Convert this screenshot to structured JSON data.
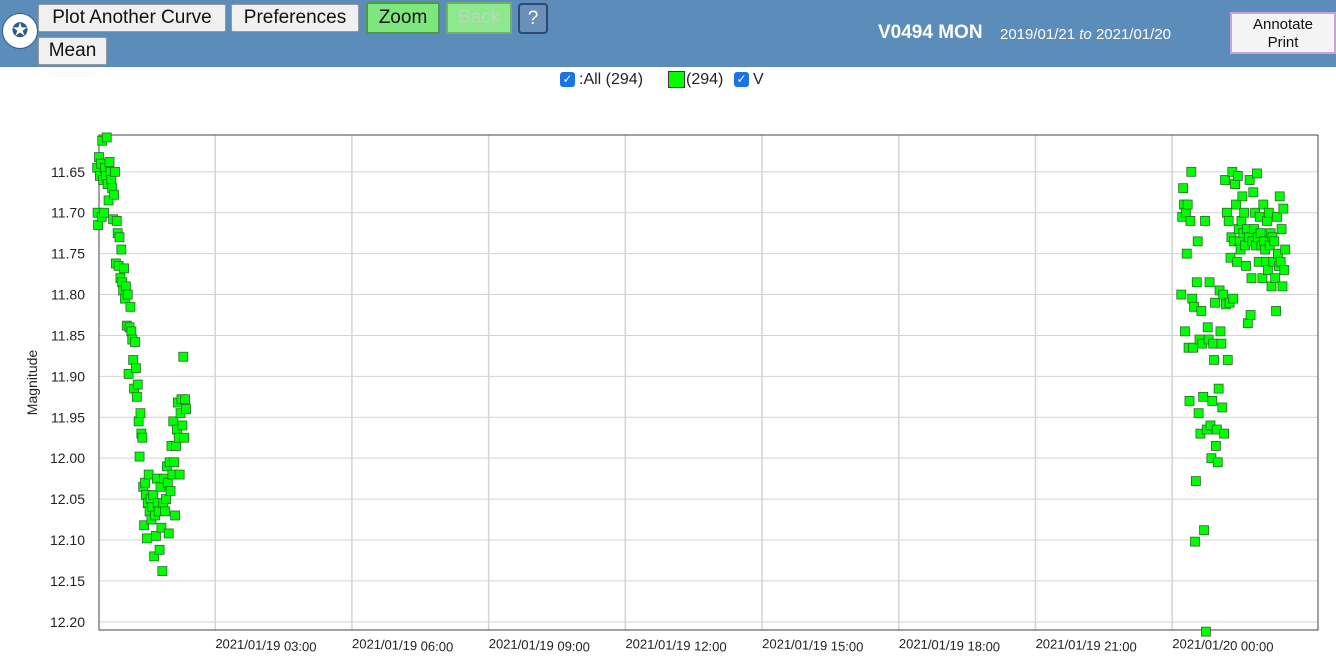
{
  "toolbar": {
    "plot_another": "Plot Another Curve",
    "preferences": "Preferences",
    "zoom": "Zoom",
    "back": "Back",
    "help": "?",
    "mean": "Mean",
    "annotate_line1": "Annotate",
    "annotate_line2": "Print"
  },
  "header": {
    "star_name": "V0494 MON",
    "date_from": "2019/01/21",
    "to_word": "to",
    "date_to": "2021/01/20"
  },
  "legend": {
    "all_label": ":All (294)",
    "count_label": "(294)",
    "band_label": "V"
  },
  "colors": {
    "header_bg": "#5b8cba",
    "point_fill": "#00ff00",
    "point_stroke": "#2a6a2a",
    "grid": "#d4d4d4"
  },
  "chart_data": {
    "type": "scatter",
    "ylabel": "Magnitude",
    "y_inverted": true,
    "ylim": [
      12.21,
      11.605
    ],
    "y_ticks": [
      11.65,
      11.7,
      11.75,
      11.8,
      11.85,
      11.9,
      11.95,
      12.0,
      12.05,
      12.1,
      12.15,
      12.2
    ],
    "y_tick_labels": [
      "11.65",
      "11.70",
      "11.75",
      "11.80",
      "11.85",
      "11.90",
      "11.95",
      "12.00",
      "12.05",
      "12.10",
      "12.15",
      "12.20"
    ],
    "x_unit": "hours after 2021/01/19 00:00",
    "xlim": [
      0.45,
      27.2
    ],
    "x_ticks": [
      3,
      6,
      9,
      12,
      15,
      18,
      21,
      24
    ],
    "x_tick_labels": [
      "2021/01/19 03:00",
      "2021/01/19 06:00",
      "2021/01/19 09:00",
      "2021/01/19 12:00",
      "2021/01/19 15:00",
      "2021/01/19 18:00",
      "2021/01/19 21:00",
      "2021/01/20 00:00"
    ],
    "grid": true,
    "legend_position": "top-center",
    "series": [
      {
        "name": "V",
        "count": 294,
        "points": [
          [
            0.41,
            11.645
          ],
          [
            0.42,
            11.7
          ],
          [
            0.43,
            11.715
          ],
          [
            0.45,
            11.632
          ],
          [
            0.47,
            11.655
          ],
          [
            0.49,
            11.64
          ],
          [
            0.51,
            11.705
          ],
          [
            0.52,
            11.612
          ],
          [
            0.54,
            11.66
          ],
          [
            0.56,
            11.7
          ],
          [
            0.58,
            11.645
          ],
          [
            0.6,
            11.655
          ],
          [
            0.62,
            11.608
          ],
          [
            0.64,
            11.665
          ],
          [
            0.66,
            11.685
          ],
          [
            0.68,
            11.638
          ],
          [
            0.7,
            11.65
          ],
          [
            0.72,
            11.66
          ],
          [
            0.74,
            11.67
          ],
          [
            0.76,
            11.708
          ],
          [
            0.78,
            11.678
          ],
          [
            0.8,
            11.65
          ],
          [
            0.82,
            11.762
          ],
          [
            0.84,
            11.71
          ],
          [
            0.86,
            11.725
          ],
          [
            0.88,
            11.765
          ],
          [
            0.9,
            11.73
          ],
          [
            0.92,
            11.78
          ],
          [
            0.94,
            11.745
          ],
          [
            0.96,
            11.785
          ],
          [
            0.98,
            11.795
          ],
          [
            1.0,
            11.768
          ],
          [
            1.02,
            11.805
          ],
          [
            1.04,
            11.79
          ],
          [
            1.06,
            11.838
          ],
          [
            1.08,
            11.8
          ],
          [
            1.1,
            11.897
          ],
          [
            1.12,
            11.84
          ],
          [
            1.14,
            11.815
          ],
          [
            1.16,
            11.845
          ],
          [
            1.18,
            11.855
          ],
          [
            1.2,
            11.88
          ],
          [
            1.22,
            11.915
          ],
          [
            1.24,
            11.858
          ],
          [
            1.26,
            11.89
          ],
          [
            1.28,
            11.925
          ],
          [
            1.3,
            11.91
          ],
          [
            1.32,
            11.955
          ],
          [
            1.34,
            11.998
          ],
          [
            1.36,
            11.945
          ],
          [
            1.38,
            11.97
          ],
          [
            1.4,
            11.975
          ],
          [
            1.42,
            12.035
          ],
          [
            1.44,
            12.082
          ],
          [
            1.46,
            12.03
          ],
          [
            1.48,
            12.045
          ],
          [
            1.5,
            12.098
          ],
          [
            1.52,
            12.055
          ],
          [
            1.54,
            12.02
          ],
          [
            1.56,
            12.065
          ],
          [
            1.58,
            12.05
          ],
          [
            1.6,
            12.075
          ],
          [
            1.62,
            12.06
          ],
          [
            1.64,
            12.045
          ],
          [
            1.66,
            12.12
          ],
          [
            1.68,
            12.07
          ],
          [
            1.7,
            12.095
          ],
          [
            1.72,
            12.025
          ],
          [
            1.74,
            12.055
          ],
          [
            1.76,
            12.065
          ],
          [
            1.78,
            12.112
          ],
          [
            1.8,
            12.035
          ],
          [
            1.82,
            12.085
          ],
          [
            1.84,
            12.138
          ],
          [
            1.86,
            12.055
          ],
          [
            1.88,
            12.025
          ],
          [
            1.9,
            12.065
          ],
          [
            1.92,
            12.05
          ],
          [
            1.94,
            12.01
          ],
          [
            1.96,
            12.03
          ],
          [
            1.98,
            12.092
          ],
          [
            2.0,
            12.005
          ],
          [
            2.02,
            12.04
          ],
          [
            2.04,
            11.985
          ],
          [
            2.06,
            12.02
          ],
          [
            2.08,
            11.955
          ],
          [
            2.1,
            12.005
          ],
          [
            2.12,
            12.07
          ],
          [
            2.14,
            11.985
          ],
          [
            2.16,
            11.965
          ],
          [
            2.18,
            11.932
          ],
          [
            2.2,
            11.975
          ],
          [
            2.22,
            12.02
          ],
          [
            2.24,
            11.945
          ],
          [
            2.26,
            11.928
          ],
          [
            2.28,
            11.96
          ],
          [
            2.3,
            11.876
          ],
          [
            2.32,
            11.975
          ],
          [
            2.34,
            11.928
          ],
          [
            2.36,
            11.94
          ],
          [
            24.2,
            11.8
          ],
          [
            24.22,
            11.705
          ],
          [
            24.24,
            11.67
          ],
          [
            24.26,
            11.69
          ],
          [
            24.28,
            11.845
          ],
          [
            24.3,
            11.7
          ],
          [
            24.32,
            11.75
          ],
          [
            24.34,
            11.69
          ],
          [
            24.36,
            11.865
          ],
          [
            24.38,
            11.93
          ],
          [
            24.4,
            11.71
          ],
          [
            24.42,
            11.65
          ],
          [
            24.44,
            11.805
          ],
          [
            24.46,
            11.865
          ],
          [
            24.48,
            11.815
          ],
          [
            24.5,
            12.102
          ],
          [
            24.52,
            12.028
          ],
          [
            24.54,
            11.785
          ],
          [
            24.56,
            11.735
          ],
          [
            24.58,
            11.945
          ],
          [
            24.6,
            11.855
          ],
          [
            24.62,
            11.97
          ],
          [
            24.64,
            11.82
          ],
          [
            24.66,
            11.86
          ],
          [
            24.68,
            11.925
          ],
          [
            24.7,
            12.088
          ],
          [
            24.72,
            11.71
          ],
          [
            24.74,
            12.212
          ],
          [
            24.76,
            11.965
          ],
          [
            24.78,
            11.84
          ],
          [
            24.8,
            11.855
          ],
          [
            24.82,
            11.785
          ],
          [
            24.84,
            11.96
          ],
          [
            24.86,
            12.0
          ],
          [
            24.88,
            11.93
          ],
          [
            24.9,
            11.86
          ],
          [
            24.92,
            11.88
          ],
          [
            24.94,
            11.81
          ],
          [
            24.96,
            11.985
          ],
          [
            24.98,
            11.965
          ],
          [
            25.0,
            12.005
          ],
          [
            25.02,
            11.915
          ],
          [
            25.04,
            11.795
          ],
          [
            25.06,
            11.845
          ],
          [
            25.08,
            11.86
          ],
          [
            25.1,
            11.938
          ],
          [
            25.12,
            11.8
          ],
          [
            25.14,
            11.97
          ],
          [
            25.16,
            11.66
          ],
          [
            25.18,
            11.812
          ],
          [
            25.2,
            11.7
          ],
          [
            25.22,
            11.88
          ],
          [
            25.24,
            11.71
          ],
          [
            25.26,
            11.81
          ],
          [
            25.28,
            11.755
          ],
          [
            25.3,
            11.73
          ],
          [
            25.32,
            11.65
          ],
          [
            25.34,
            11.805
          ],
          [
            25.36,
            11.735
          ],
          [
            25.38,
            11.665
          ],
          [
            25.4,
            11.69
          ],
          [
            25.42,
            11.76
          ],
          [
            25.44,
            11.655
          ],
          [
            25.46,
            11.72
          ],
          [
            25.48,
            11.735
          ],
          [
            25.5,
            11.745
          ],
          [
            25.52,
            11.71
          ],
          [
            25.54,
            11.68
          ],
          [
            25.56,
            11.725
          ],
          [
            25.58,
            11.7
          ],
          [
            25.6,
            11.74
          ],
          [
            25.62,
            11.765
          ],
          [
            25.64,
            11.72
          ],
          [
            25.66,
            11.835
          ],
          [
            25.68,
            11.73
          ],
          [
            25.7,
            11.66
          ],
          [
            25.72,
            11.825
          ],
          [
            25.74,
            11.78
          ],
          [
            25.76,
            11.735
          ],
          [
            25.78,
            11.675
          ],
          [
            25.8,
            11.72
          ],
          [
            25.82,
            11.7
          ],
          [
            25.84,
            11.74
          ],
          [
            25.86,
            11.652
          ],
          [
            25.88,
            11.73
          ],
          [
            25.9,
            11.76
          ],
          [
            25.92,
            11.705
          ],
          [
            25.94,
            11.725
          ],
          [
            25.96,
            11.74
          ],
          [
            25.98,
            11.78
          ],
          [
            26.0,
            11.69
          ],
          [
            26.02,
            11.735
          ],
          [
            26.04,
            11.745
          ],
          [
            26.06,
            11.76
          ],
          [
            26.08,
            11.71
          ],
          [
            26.1,
            11.77
          ],
          [
            26.12,
            11.7
          ],
          [
            26.14,
            11.74
          ],
          [
            26.16,
            11.725
          ],
          [
            26.18,
            11.79
          ],
          [
            26.2,
            11.73
          ],
          [
            26.22,
            11.76
          ],
          [
            26.24,
            11.735
          ],
          [
            26.26,
            11.78
          ],
          [
            26.28,
            11.82
          ],
          [
            26.3,
            11.705
          ],
          [
            26.32,
            11.75
          ],
          [
            26.34,
            11.765
          ],
          [
            26.36,
            11.68
          ],
          [
            26.38,
            11.76
          ],
          [
            26.4,
            11.72
          ],
          [
            26.42,
            11.79
          ],
          [
            26.44,
            11.695
          ],
          [
            26.46,
            11.77
          ],
          [
            26.48,
            11.745
          ]
        ]
      }
    ]
  }
}
